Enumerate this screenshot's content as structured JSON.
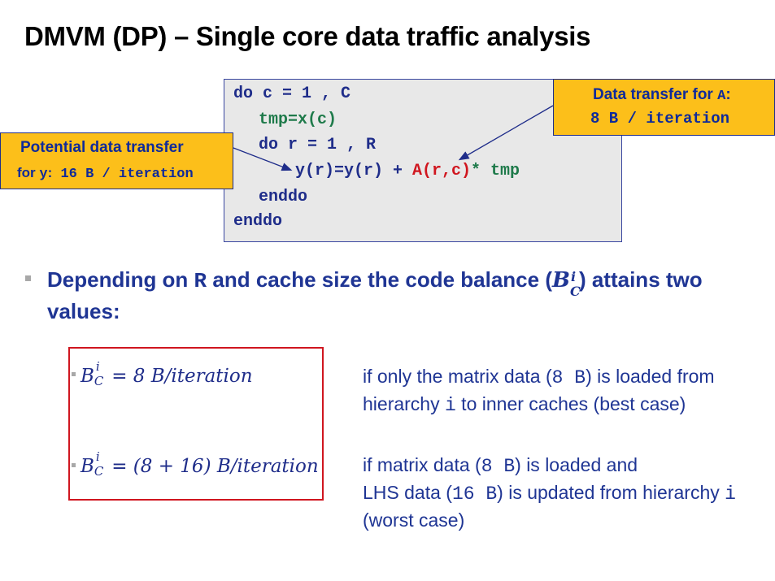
{
  "slide": {
    "title": "DMVM (DP) – Single core data traffic analysis"
  },
  "code": {
    "line1": "do c = 1 , C",
    "line2": "tmp=x(c)",
    "line3": "do r = 1 , R",
    "line4_a": "y(r)=y(r) + ",
    "line4_b": "A(r,c)",
    "line4_c": "* tmp",
    "line5": "enddo",
    "line6": "enddo"
  },
  "callouts": {
    "a": {
      "heading": "Data transfer for ",
      "heading_code": "A",
      "heading_suffix": ":",
      "value": "8 B / iteration"
    },
    "y": {
      "heading": "Potential data transfer",
      "prefix": "for ",
      "var": "y",
      "colon": ":",
      "value": " 16 B / iteration"
    }
  },
  "bullet": {
    "part1": "Depending on ",
    "code": "R",
    "part2": " and cache size the code balance (",
    "sym": "B",
    "sup": "i",
    "sub": "C",
    "part3": ") attains two",
    "line2": "values:"
  },
  "formulas": [
    {
      "B": "B",
      "sup": "i",
      "sub": "C",
      "rhs": " = 8 B/iteration",
      "desc_l1_a": "if only the matrix data (",
      "desc_l1_code": "8 B",
      "desc_l1_b": ") is loaded from",
      "desc_l2_a": "hierarchy ",
      "desc_l2_code": "i",
      "desc_l2_b": " to inner caches (best case)"
    },
    {
      "B": "B",
      "sup": "i",
      "sub": "C",
      "rhs": " = (8 + 16) B/iteration",
      "desc_l1_a": "if matrix data (",
      "desc_l1_code": "8 B",
      "desc_l1_b": ") is loaded and",
      "desc_l2_a": "LHS data (",
      "desc_l2_code": "16 B",
      "desc_l2_b": ") is updated from hierarchy ",
      "desc_l2_code2": "i",
      "desc_l3": "(worst case)"
    }
  ],
  "colors": {
    "accent_navy": "#1f3594",
    "code_green": "#1e7a4a",
    "code_red": "#d0161f",
    "callout_yellow": "#fcbf1a",
    "code_bg": "#e8e8e8"
  }
}
